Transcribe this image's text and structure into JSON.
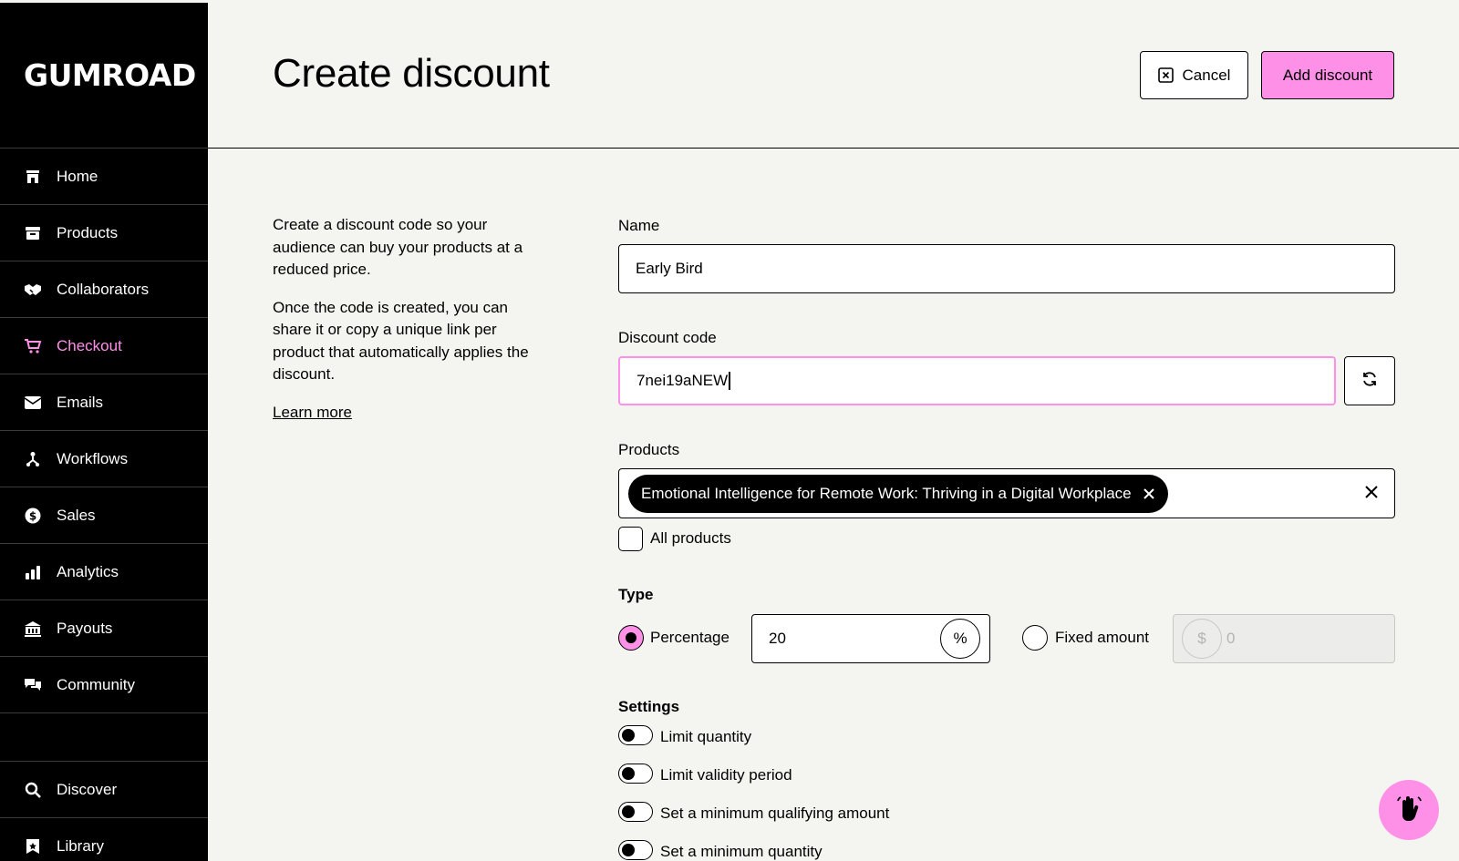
{
  "brand": {
    "logo_text": "GUMROAD"
  },
  "sidebar": {
    "items": [
      {
        "label": "Home",
        "icon": "store-icon"
      },
      {
        "label": "Products",
        "icon": "archive-icon"
      },
      {
        "label": "Collaborators",
        "icon": "handshake-icon"
      },
      {
        "label": "Checkout",
        "icon": "cart-icon",
        "active": true
      },
      {
        "label": "Emails",
        "icon": "envelope-icon"
      },
      {
        "label": "Workflows",
        "icon": "workflow-icon"
      },
      {
        "label": "Sales",
        "icon": "dollar-circle-icon"
      },
      {
        "label": "Analytics",
        "icon": "bar-chart-icon"
      },
      {
        "label": "Payouts",
        "icon": "bank-icon"
      },
      {
        "label": "Community",
        "icon": "chat-bubbles-icon"
      }
    ],
    "bottom_items": [
      {
        "label": "Discover",
        "icon": "search-icon"
      },
      {
        "label": "Library",
        "icon": "bookmark-icon"
      }
    ]
  },
  "header": {
    "title": "Create discount",
    "cancel_label": "Cancel",
    "add_label": "Add discount"
  },
  "intro": {
    "paragraph1": "Create a discount code so your audience can buy your products at a reduced price.",
    "paragraph2": "Once the code is created, you can share it or copy a unique link per product that automatically applies the discount.",
    "learn_more": "Learn more"
  },
  "form": {
    "name_label": "Name",
    "name_value": "Early Bird",
    "code_label": "Discount code",
    "code_value": "7nei19aNEW",
    "products_label": "Products",
    "selected_product": "Emotional Intelligence for Remote Work: Thriving in a Digital Workplace",
    "all_products_label": "All products",
    "all_products_checked": false,
    "type_label": "Type",
    "percentage_label": "Percentage",
    "percentage_value": "20",
    "percentage_suffix": "%",
    "percentage_selected": true,
    "fixed_label": "Fixed amount",
    "fixed_prefix": "$",
    "fixed_value": "0",
    "settings_label": "Settings",
    "settings": [
      {
        "label": "Limit quantity",
        "on": false
      },
      {
        "label": "Limit validity period",
        "on": false
      },
      {
        "label": "Set a minimum qualifying amount",
        "on": false
      },
      {
        "label": "Set a minimum quantity",
        "on": false
      }
    ]
  },
  "colors": {
    "accent": "#ff90e8",
    "sidebar_bg": "#000000",
    "page_bg": "#f4f4f0"
  }
}
